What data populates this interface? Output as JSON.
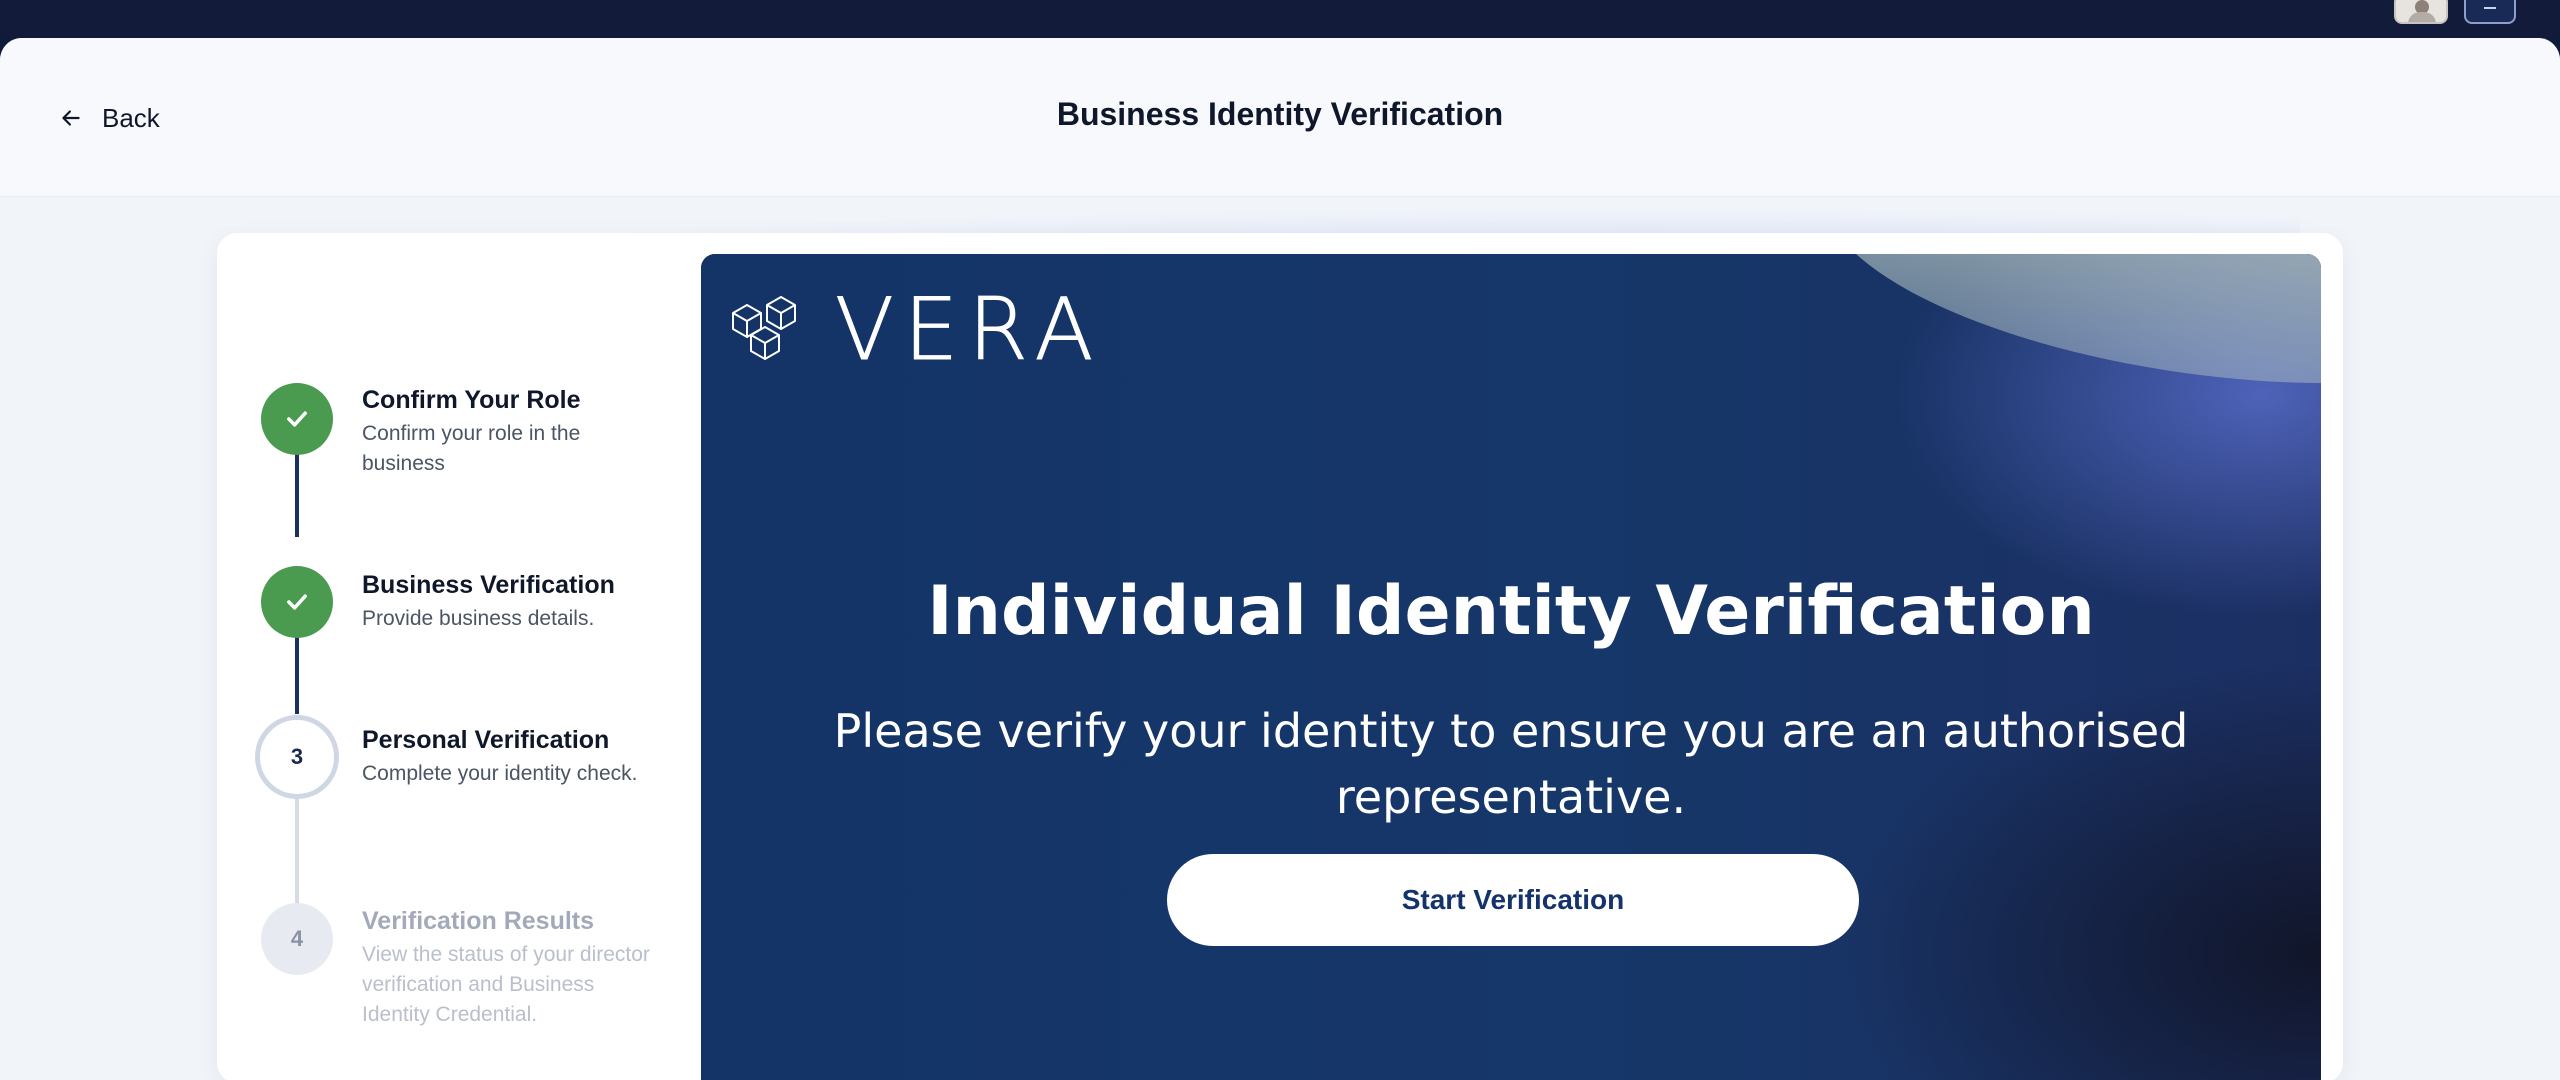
{
  "header": {
    "back_label": "Back",
    "title": "Business Identity Verification"
  },
  "steps": [
    {
      "title": "Confirm Your Role",
      "desc": "Confirm your role in the business",
      "status": "complete"
    },
    {
      "title": "Business Verification",
      "desc": "Provide business details.",
      "status": "complete"
    },
    {
      "number": "3",
      "title": "Personal Verification",
      "desc": "Complete your identity check.",
      "status": "current"
    },
    {
      "number": "4",
      "title": "Verification Results",
      "desc": "View the status of your director verification and Business Identity Credential.",
      "status": "upcoming"
    }
  ],
  "hero": {
    "logo_text": "VERA",
    "title": "Individual Identity Verification",
    "subtitle": "Please verify your identity to ensure you are an authorised representative.",
    "button_label": "Start Verification"
  },
  "colors": {
    "complete": "#4a9a50",
    "hero_bg": "#14336a",
    "topbar": "#121c3a"
  }
}
